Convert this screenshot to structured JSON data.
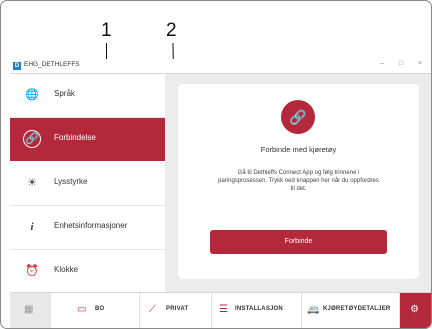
{
  "callouts": {
    "one": "1",
    "two": "2"
  },
  "window": {
    "title": "EHG_DETHLEFFS",
    "logo_glyph": "D",
    "controls": {
      "minimize": "–",
      "maximize": "□",
      "close": "×"
    }
  },
  "sidebar": {
    "items": [
      {
        "label": "Språk",
        "icon": "globe-icon",
        "glyph": "🌐",
        "active": false
      },
      {
        "label": "Forbindelse",
        "icon": "link-icon",
        "glyph": "🔗",
        "active": true
      },
      {
        "label": "Lysstyrke",
        "icon": "brightness-icon",
        "glyph": "☀",
        "active": false
      },
      {
        "label": "Enhetsinformasjoner",
        "icon": "info-icon",
        "glyph": "i",
        "active": false
      },
      {
        "label": "Klokke",
        "icon": "alarm-clock-icon",
        "glyph": "⏰",
        "active": false
      }
    ]
  },
  "connection_card": {
    "icon": "link-icon",
    "glyph": "🔗",
    "title": "Forbinde med kjøretøy",
    "description": "Gå til Dethleffs Connect App og følg trinnene i paringsprosessen. Trykk ned knappen her når du oppfordres til det.",
    "button_label": "Forbinde"
  },
  "bottom_nav": {
    "items": [
      {
        "label": "",
        "icon": "grid-icon",
        "glyph": "▦"
      },
      {
        "label": "BO",
        "icon": "living-room-icon",
        "glyph": "▭"
      },
      {
        "label": "PRIVAT",
        "icon": "privacy-icon",
        "glyph": "⟋"
      },
      {
        "label": "INSTALLASJON",
        "icon": "installation-icon",
        "glyph": "☰"
      },
      {
        "label": "KJØRETØYDETALJER",
        "icon": "vehicle-icon",
        "glyph": "🚐"
      },
      {
        "label": "",
        "icon": "settings-gear-icon",
        "glyph": "⚙"
      }
    ]
  },
  "colors": {
    "accent": "#b3283b",
    "background": "#ececec"
  }
}
